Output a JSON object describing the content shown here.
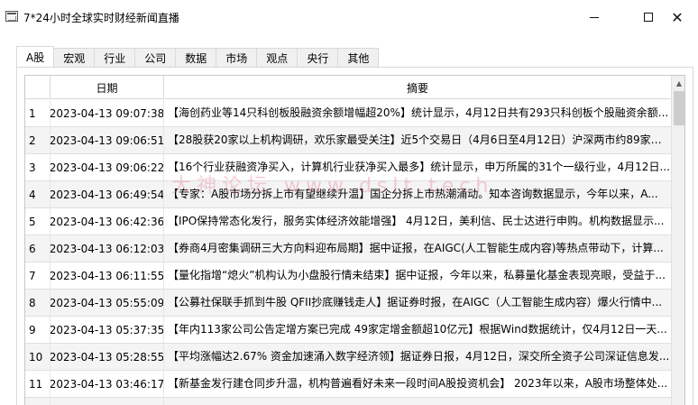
{
  "window": {
    "title": "7*24小时全球实时财经新闻直播",
    "minimize_glyph": "—",
    "maximize_glyph": "☐",
    "close_glyph": "✕"
  },
  "tabs": [
    {
      "label": "A股",
      "active": true
    },
    {
      "label": "宏观",
      "active": false
    },
    {
      "label": "行业",
      "active": false
    },
    {
      "label": "公司",
      "active": false
    },
    {
      "label": "数据",
      "active": false
    },
    {
      "label": "市场",
      "active": false
    },
    {
      "label": "观点",
      "active": false
    },
    {
      "label": "央行",
      "active": false
    },
    {
      "label": "其他",
      "active": false
    }
  ],
  "table": {
    "columns": {
      "index": "",
      "date": "日期",
      "summary": "摘要"
    },
    "rows": [
      {
        "index": "1",
        "date": "2023-04-13 09:07:38",
        "summary": "【海创药业等14只科创板股融资余额增幅超20%】统计显示，4月12日共有293只科创板个股融资余额..."
      },
      {
        "index": "2",
        "date": "2023-04-13 09:06:51",
        "summary": "【28股获20家以上机构调研，欢乐家最受关注】近5个交易日（4月6日至4月12日）沪深两市约89家公..."
      },
      {
        "index": "3",
        "date": "2023-04-13 09:06:22",
        "summary": "【16个行业获融资净买入，计算机行业获净买入最多】统计显示，申万所属的31个一级行业，4月12日..."
      },
      {
        "index": "4",
        "date": "2023-04-13 06:49:54",
        "summary": "【专家：A股市场分拆上市有望继续升温】国企分拆上市热潮涌动。知本咨询数据显示，今年以来，A..."
      },
      {
        "index": "5",
        "date": "2023-04-13 06:42:36",
        "summary": "【IPO保持常态化发行，服务实体经济效能增强】 4月12日，美利信、民士达进行申购。机构数据显示..."
      },
      {
        "index": "6",
        "date": "2023-04-13 06:12:03",
        "summary": "【券商4月密集调研三大方向料迎布局期】据中证报，在AIGC(人工智能生成内容)等热点带动下，计算..."
      },
      {
        "index": "7",
        "date": "2023-04-13 06:11:55",
        "summary": "【量化指增“熄火”机构认为小盘股行情未结束】据中证报，今年以来，私募量化基金表现亮眼，受益于..."
      },
      {
        "index": "8",
        "date": "2023-04-13 05:55:09",
        "summary": "【公募社保联手抓到牛股 QFII抄底赚钱走人】据证券时报，在AIGC（人工智能生成内容）爆火行情中..."
      },
      {
        "index": "9",
        "date": "2023-04-13 05:37:35",
        "summary": "【年内113家公司公告定增方案已完成 49家定增金额超10亿元】根据Wind数据统计，仅4月12日一天..."
      },
      {
        "index": "10",
        "date": "2023-04-13 05:28:55",
        "summary": "【平均涨幅达2.67% 资金加速涌入数字经济领】据证券日报，4月12日，深交所全资子公司深证信息发..."
      },
      {
        "index": "11",
        "date": "2023-04-13 03:46:17",
        "summary": "【新基金发行建仓同步升温，机构普遍看好未来一段时间A股投资机会】 2023年以来，A股市场整体处..."
      },
      {
        "index": "",
        "date": "",
        "summary": ""
      }
    ]
  },
  "watermark": "大神论坛  www.dslt.tech",
  "scrollbar": {
    "up_arrow": "▲"
  }
}
